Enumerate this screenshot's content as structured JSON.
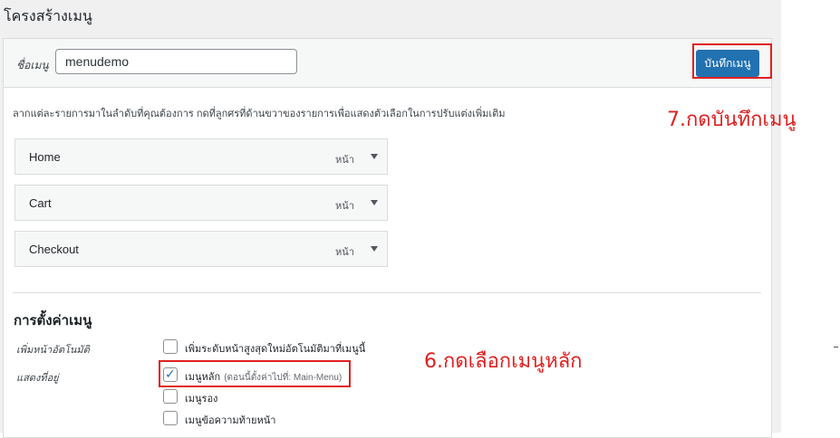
{
  "page": {
    "title": "โครงสร้างเมนู"
  },
  "header": {
    "name_label": "ชื่อเมนู",
    "name_value": "menudemo",
    "save_label": "บันทึกเมนู"
  },
  "instructions": "ลากแต่ละรายการมาในลำดับที่คุณต้องการ กดที่ลูกศรที่ด้านขวาของรายการเพื่อแสดงตัวเลือกในการปรับแต่งเพิ่มเติม",
  "menu_items": [
    {
      "title": "Home",
      "type": "หน้า"
    },
    {
      "title": "Cart",
      "type": "หน้า"
    },
    {
      "title": "Checkout",
      "type": "หน้า"
    }
  ],
  "settings": {
    "title": "การตั้งค่าเมนู",
    "auto_add_label": "เพิ่มหน้าอัตโนมัติ",
    "auto_add_option": {
      "label": "เพิ่มระดับหน้าสูงสุดใหม่อัตโนมัติมาที่เมนูนี้",
      "checked": false
    },
    "display_label": "แสดงที่อยู่",
    "locations": [
      {
        "label": "เมนูหลัก",
        "note": "(ตอนนี้ตั้งค่าไปที่: Main-Menu)",
        "checked": true
      },
      {
        "label": "เมนูรอง",
        "note": "",
        "checked": false
      },
      {
        "label": "เมนูข้อความท้ายหน้า",
        "note": "",
        "checked": false
      }
    ]
  },
  "annotations": {
    "save": "7.กดบันทึกเมนู",
    "select_main": "6.กดเลือกเมนูหลัก"
  },
  "colors": {
    "primary": "#2271b1",
    "highlight": "#e02020"
  }
}
